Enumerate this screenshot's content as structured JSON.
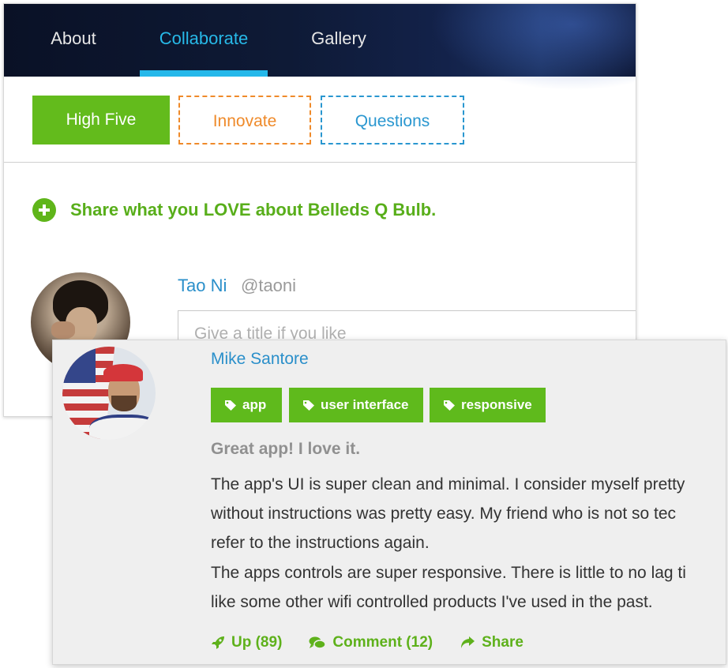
{
  "nav": {
    "items": [
      {
        "label": "About"
      },
      {
        "label": "Collaborate"
      },
      {
        "label": "Gallery"
      }
    ],
    "active": "Collaborate"
  },
  "tabs": {
    "high_five": "High Five",
    "innovate": "Innovate",
    "questions": "Questions"
  },
  "share_prompt": "Share what you LOVE about Belleds Q Bulb.",
  "composer": {
    "user_name": "Tao Ni",
    "user_handle": "@taoni",
    "title_placeholder": "Give a title if you like"
  },
  "post": {
    "author": "Mike Santore",
    "tags": [
      "app",
      "user interface",
      "responsive"
    ],
    "title": "Great app! I love it.",
    "paragraph1_lines": [
      "The app's UI is super clean and minimal. I consider myself pretty",
      "without instructions was pretty easy. My friend who is not so tec",
      "refer to the instructions again."
    ],
    "paragraph2_lines": [
      "The apps controls are super responsive. There is little to no lag ti",
      "like some other wifi controlled products I've used in the past."
    ],
    "actions": {
      "up": "Up (89)",
      "comment": "Comment (12)",
      "share": "Share"
    }
  },
  "colors": {
    "accent_green": "#5fb51a",
    "link_blue": "#2a8fca",
    "nav_active": "#27b9e8",
    "innovate_orange": "#ef8a2a",
    "questions_blue": "#2a97d0"
  },
  "icons": [
    "plus-circle-icon",
    "tag-icon",
    "rocket-icon",
    "comment-icon",
    "share-arrow-icon"
  ]
}
